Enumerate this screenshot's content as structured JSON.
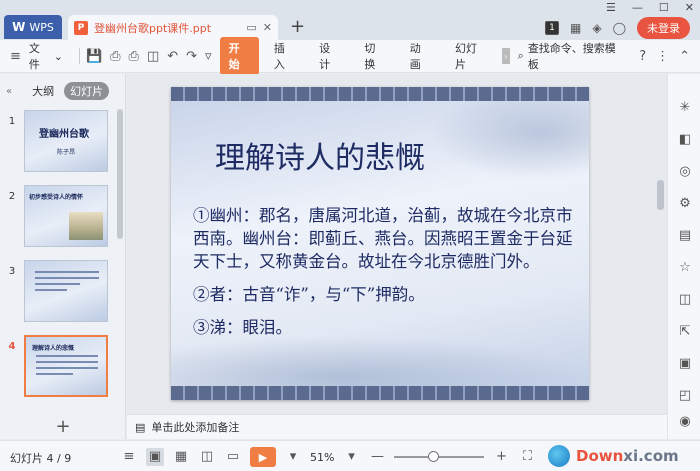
{
  "titlebar": {
    "wps_label": "WPS",
    "doc_tab_name": "登幽州台歌ppt课件.ppt",
    "new_tab": "+",
    "badge": "1",
    "login_label": "未登录"
  },
  "toolbar": {
    "file_label": "文件",
    "tabs": [
      "开始",
      "插入",
      "设计",
      "切换",
      "动画",
      "幻灯片"
    ],
    "search_cmd": "查找命令、搜索模板"
  },
  "leftpanel": {
    "tab_outline": "大纲",
    "tab_slides": "幻灯片",
    "thumbs": [
      {
        "num": "1",
        "title": "登幽州台歌",
        "subtitle": "陈子昂"
      },
      {
        "num": "2",
        "title": "初步感受诗人的情怀"
      },
      {
        "num": "3",
        "title": ""
      },
      {
        "num": "4",
        "title": "理解诗人的悲慨"
      }
    ]
  },
  "slide": {
    "title": "理解诗人的悲慨",
    "para1": "①幽州：郡名，唐属河北道，治蓟，故城在今北京市西南。幽州台：即蓟丘、燕台。因燕昭王置金于台延天下士，又称黄金台。故址在今北京德胜门外。",
    "para2": "②者：古音“诈”，与“下”押韵。",
    "para3": "③涕：眼泪。"
  },
  "notes": {
    "placeholder": "单击此处添加备注"
  },
  "status": {
    "slide_count": "幻灯片 4 / 9",
    "zoom": "51%",
    "watermark_a": "Down",
    "watermark_b": "xi.com"
  }
}
